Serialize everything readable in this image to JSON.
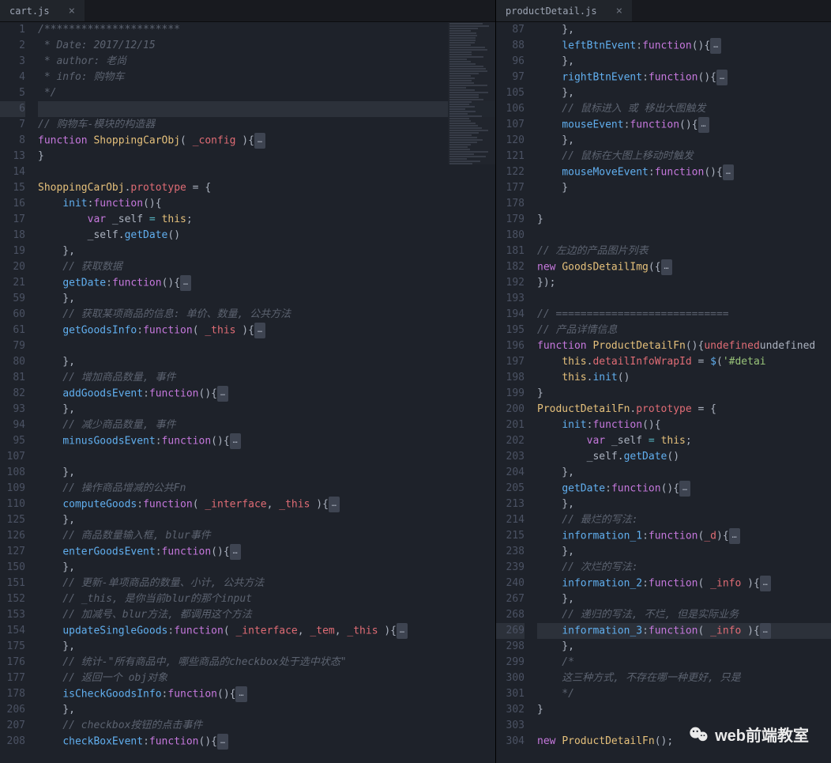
{
  "tabs": {
    "left": "cart.js",
    "right": "productDetail.js"
  },
  "watermark": "web前端教室",
  "left": {
    "nums": [
      "1",
      "2",
      "3",
      "4",
      "5",
      "6",
      "7",
      "8",
      "13",
      "14",
      "15",
      "16",
      "17",
      "18",
      "19",
      "20",
      "21",
      "59",
      "60",
      "61",
      "79",
      "80",
      "81",
      "82",
      "93",
      "94",
      "95",
      "107",
      "108",
      "109",
      "110",
      "125",
      "126",
      "127",
      "150",
      "151",
      "152",
      "153",
      "154",
      "175",
      "176",
      "177",
      "178",
      "206",
      "207",
      "208"
    ],
    "lines": [
      {
        "t": "cm",
        "x": "/**********************"
      },
      {
        "t": "cm",
        "x": " * Date: 2017/12/15"
      },
      {
        "t": "cm",
        "x": " * author: 老尚"
      },
      {
        "t": "cm",
        "x": " * info: 购物车"
      },
      {
        "t": "cm",
        "x": " */"
      },
      {
        "t": "hl",
        "x": ""
      },
      {
        "t": "cm",
        "x": "// 购物车-模块的构造器"
      },
      {
        "t": "func",
        "x": [
          "function ",
          "ShoppingCarObj",
          "( ",
          "_config",
          " ){",
          "…"
        ]
      },
      {
        "t": "pl",
        "x": "}"
      },
      {
        "t": "pl",
        "x": ""
      },
      {
        "t": "proto",
        "x": [
          "ShoppingCarObj",
          ".",
          "prototype",
          " = {"
        ]
      },
      {
        "t": "method",
        "x": [
          "    ",
          "init",
          ":",
          "function",
          "(){"
        ]
      },
      {
        "t": "var",
        "x": [
          "        ",
          "var",
          " _self ",
          "=",
          " ",
          "this",
          ";"
        ]
      },
      {
        "t": "call",
        "x": [
          "        _self.",
          "getDate",
          "()"
        ]
      },
      {
        "t": "pl",
        "x": "    },"
      },
      {
        "t": "cm",
        "x": "    // 获取数据"
      },
      {
        "t": "methodf",
        "x": [
          "    ",
          "getDate",
          ":",
          "function",
          "(){",
          "…"
        ]
      },
      {
        "t": "pl",
        "x": "    },"
      },
      {
        "t": "cm",
        "x": "    // 获取某项商品的信息: 单价、数量, 公共方法"
      },
      {
        "t": "methodf",
        "x": [
          "    ",
          "getGoodsInfo",
          ":",
          "function",
          "( ",
          "_this",
          " ){",
          "…"
        ]
      },
      {
        "t": "pl",
        "x": ""
      },
      {
        "t": "pl",
        "x": "    },"
      },
      {
        "t": "cm",
        "x": "    // 增加商品数量, 事件"
      },
      {
        "t": "methodf",
        "x": [
          "    ",
          "addGoodsEvent",
          ":",
          "function",
          "(){",
          "…"
        ]
      },
      {
        "t": "pl",
        "x": "    },"
      },
      {
        "t": "cm",
        "x": "    // 减少商品数量, 事件"
      },
      {
        "t": "methodf",
        "x": [
          "    ",
          "minusGoodsEvent",
          ":",
          "function",
          "(){",
          "…"
        ]
      },
      {
        "t": "pl",
        "x": ""
      },
      {
        "t": "pl",
        "x": "    },"
      },
      {
        "t": "cm",
        "x": "    // 操作商品增减的公共Fn"
      },
      {
        "t": "methodf",
        "x": [
          "    ",
          "computeGoods",
          ":",
          "function",
          "( ",
          "_interface",
          ", ",
          "_this",
          " ){",
          "…"
        ]
      },
      {
        "t": "pl",
        "x": "    },"
      },
      {
        "t": "cm",
        "x": "    // 商品数量输入框, blur事件"
      },
      {
        "t": "methodf",
        "x": [
          "    ",
          "enterGoodsEvent",
          ":",
          "function",
          "(){",
          "…"
        ]
      },
      {
        "t": "pl",
        "x": "    },"
      },
      {
        "t": "cm",
        "x": "    // 更新-单项商品的数量、小计, 公共方法"
      },
      {
        "t": "cm",
        "x": "    // _this, 是你当前blur的那个input"
      },
      {
        "t": "cm",
        "x": "    // 加减号、blur方法, 都调用这个方法"
      },
      {
        "t": "methodf",
        "x": [
          "    ",
          "updateSingleGoods",
          ":",
          "function",
          "( ",
          "_interface",
          ", ",
          "_tem",
          ", ",
          "_this",
          " ){",
          "…"
        ]
      },
      {
        "t": "pl",
        "x": "    },"
      },
      {
        "t": "cm",
        "x": "    // 统计-\"所有商品中, 哪些商品的checkbox处于选中状态\""
      },
      {
        "t": "cm",
        "x": "    // 返回一个 obj对象"
      },
      {
        "t": "methodf",
        "x": [
          "    ",
          "isCheckGoodsInfo",
          ":",
          "function",
          "(){",
          "…"
        ]
      },
      {
        "t": "pl",
        "x": "    },"
      },
      {
        "t": "cm",
        "x": "    // checkbox按钮的点击事件"
      },
      {
        "t": "methodf",
        "x": [
          "    ",
          "checkBoxEvent",
          ":",
          "function",
          "(){",
          "…"
        ]
      }
    ]
  },
  "right": {
    "nums": [
      "87",
      "88",
      "96",
      "97",
      "105",
      "106",
      "107",
      "120",
      "121",
      "122",
      "177",
      "178",
      "179",
      "180",
      "181",
      "182",
      "192",
      "193",
      "194",
      "195",
      "196",
      "197",
      "198",
      "199",
      "200",
      "201",
      "202",
      "203",
      "204",
      "205",
      "213",
      "214",
      "215",
      "238",
      "239",
      "240",
      "267",
      "268",
      "269",
      "298",
      "299",
      "300",
      "301",
      "302",
      "303",
      "304"
    ],
    "lines": [
      {
        "t": "pl",
        "x": "    },"
      },
      {
        "t": "methodf",
        "x": [
          "    ",
          "leftBtnEvent",
          ":",
          "function",
          "(){",
          "…"
        ]
      },
      {
        "t": "pl",
        "x": "    },"
      },
      {
        "t": "methodf",
        "x": [
          "    ",
          "rightBtnEvent",
          ":",
          "function",
          "(){",
          "…"
        ]
      },
      {
        "t": "pl",
        "x": "    },"
      },
      {
        "t": "cm",
        "x": "    // 鼠标进入 或 移出大图触发"
      },
      {
        "t": "methodf",
        "x": [
          "    ",
          "mouseEvent",
          ":",
          "function",
          "(){",
          "…"
        ]
      },
      {
        "t": "pl",
        "x": "    },"
      },
      {
        "t": "cm",
        "x": "    // 鼠标在大图上移动时触发"
      },
      {
        "t": "methodf",
        "x": [
          "    ",
          "mouseMoveEvent",
          ":",
          "function",
          "(){",
          "…"
        ]
      },
      {
        "t": "pl",
        "x": "    }"
      },
      {
        "t": "pl",
        "x": ""
      },
      {
        "t": "pl",
        "x": "}"
      },
      {
        "t": "pl",
        "x": ""
      },
      {
        "t": "cm",
        "x": "// 左边的产品图片列表"
      },
      {
        "t": "new",
        "x": [
          "new",
          " ",
          "GoodsDetailImg",
          "({",
          "…"
        ]
      },
      {
        "t": "pl",
        "x": "});"
      },
      {
        "t": "pl",
        "x": ""
      },
      {
        "t": "cm",
        "x": "// ============================"
      },
      {
        "t": "cm",
        "x": "// 产品详情信息"
      },
      {
        "t": "func",
        "x": [
          "function ",
          "ProductDetailFn",
          "(){"
        ]
      },
      {
        "t": "assign",
        "x": [
          "    ",
          "this",
          ".",
          "detailInfoWrapId",
          " = ",
          "$",
          "(",
          "'#detai"
        ]
      },
      {
        "t": "call",
        "x": [
          "    ",
          "this",
          ".",
          "init",
          "()"
        ]
      },
      {
        "t": "pl",
        "x": "}"
      },
      {
        "t": "proto",
        "x": [
          "ProductDetailFn",
          ".",
          "prototype",
          " = {"
        ]
      },
      {
        "t": "method",
        "x": [
          "    ",
          "init",
          ":",
          "function",
          "(){"
        ]
      },
      {
        "t": "var",
        "x": [
          "        ",
          "var",
          " _self ",
          "=",
          " ",
          "this",
          ";"
        ]
      },
      {
        "t": "call",
        "x": [
          "        _self.",
          "getDate",
          "()"
        ]
      },
      {
        "t": "pl",
        "x": "    },"
      },
      {
        "t": "methodf",
        "x": [
          "    ",
          "getDate",
          ":",
          "function",
          "(){",
          "…"
        ]
      },
      {
        "t": "pl",
        "x": "    },"
      },
      {
        "t": "cm",
        "x": "    // 最烂的写法:"
      },
      {
        "t": "methodf",
        "x": [
          "    ",
          "information_1",
          ":",
          "function",
          "(",
          "_d",
          "){",
          "…"
        ]
      },
      {
        "t": "pl",
        "x": "    },"
      },
      {
        "t": "cm",
        "x": "    // 次烂的写法:"
      },
      {
        "t": "methodf",
        "x": [
          "    ",
          "information_2",
          ":",
          "function",
          "( ",
          "_info",
          " ){",
          "…"
        ]
      },
      {
        "t": "pl",
        "x": "    },"
      },
      {
        "t": "cm",
        "x": "    // 递归的写法, 不烂, 但是实际业务"
      },
      {
        "t": "methodf",
        "x": [
          "    ",
          "information_3",
          ":",
          "function",
          "( ",
          "_info",
          " ){",
          "…"
        ],
        "hl": true
      },
      {
        "t": "pl",
        "x": "    },"
      },
      {
        "t": "cm",
        "x": "    /*"
      },
      {
        "t": "cm",
        "x": "    这三种方式, 不存在哪一种更好, 只是"
      },
      {
        "t": "cm",
        "x": "    */"
      },
      {
        "t": "pl",
        "x": "}"
      },
      {
        "t": "pl",
        "x": ""
      },
      {
        "t": "new",
        "x": [
          "new",
          " ",
          "ProductDetailFn",
          "();"
        ]
      }
    ]
  }
}
